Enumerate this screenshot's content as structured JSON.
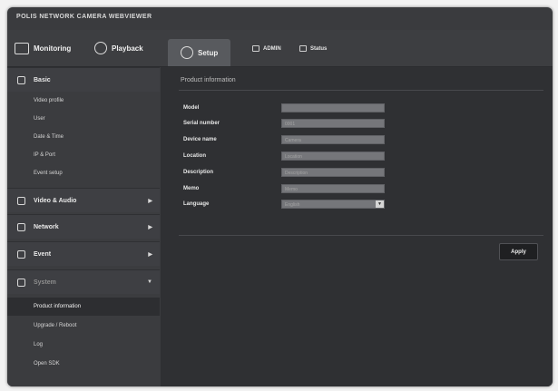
{
  "brand": "POLIS NETWORK CAMERA WEBVIEWER",
  "nav": {
    "monitoring": "Monitoring",
    "playback": "Playback",
    "setup": "Setup",
    "admin": "ADMIN",
    "status": "Status"
  },
  "sidebar": {
    "basic": "Basic",
    "basic_items": [
      "Video profile",
      "User",
      "Date & Time",
      "IP & Port",
      "Event setup"
    ],
    "video_audio": "Video & Audio",
    "network": "Network",
    "event": "Event",
    "system": "System",
    "system_items": [
      "Product information",
      "Upgrade / Reboot",
      "Log",
      "Open SDK"
    ]
  },
  "content": {
    "section_title": "Product information",
    "fields": [
      {
        "label": "Model",
        "value": ""
      },
      {
        "label": "Serial number",
        "value": "0001"
      },
      {
        "label": "Device name",
        "value": "Camera"
      },
      {
        "label": "Location",
        "value": "Location"
      },
      {
        "label": "Description",
        "value": "Description"
      },
      {
        "label": "Memo",
        "value": "Memo"
      },
      {
        "label": "Language",
        "value": "English"
      }
    ],
    "apply": "Apply"
  }
}
